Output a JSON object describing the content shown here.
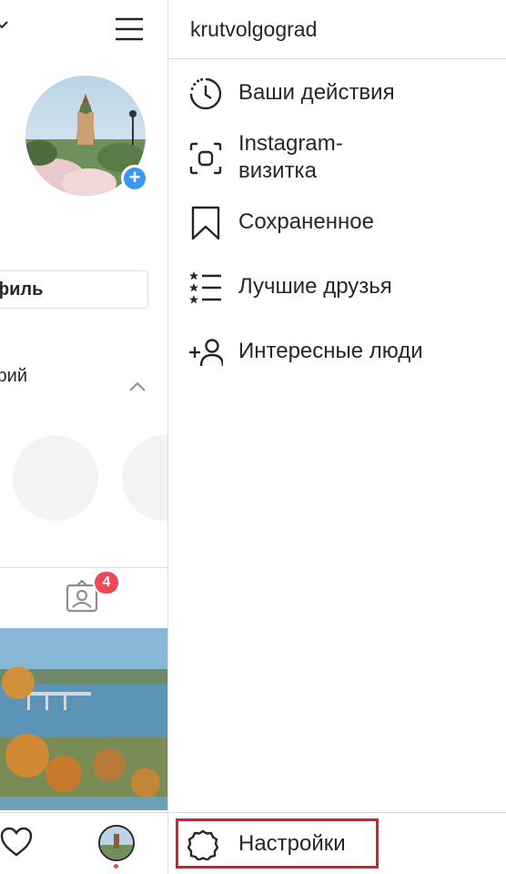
{
  "profile_panel": {
    "edit_profile_label": "Редактировать профиль",
    "stories_label": "Актуальное из историй",
    "tagged_badge_count": "4"
  },
  "drawer": {
    "username": "krutvolgograd",
    "items": [
      {
        "label": "Ваши действия",
        "icon": "activity-clock-icon"
      },
      {
        "label": "Instagram-\nвизитка",
        "icon": "nametag-icon"
      },
      {
        "label": "Сохраненное",
        "icon": "bookmark-icon"
      },
      {
        "label": "Лучшие друзья",
        "icon": "close-friends-list-icon"
      },
      {
        "label": "Интересные люди",
        "icon": "discover-people-icon"
      }
    ],
    "settings_label": "Настройки"
  },
  "colors": {
    "accent_blue": "#3897f0",
    "badge_red": "#ed4956",
    "highlight_outline": "#d7202d",
    "divider": "#dbdbdb",
    "text": "#262626"
  }
}
